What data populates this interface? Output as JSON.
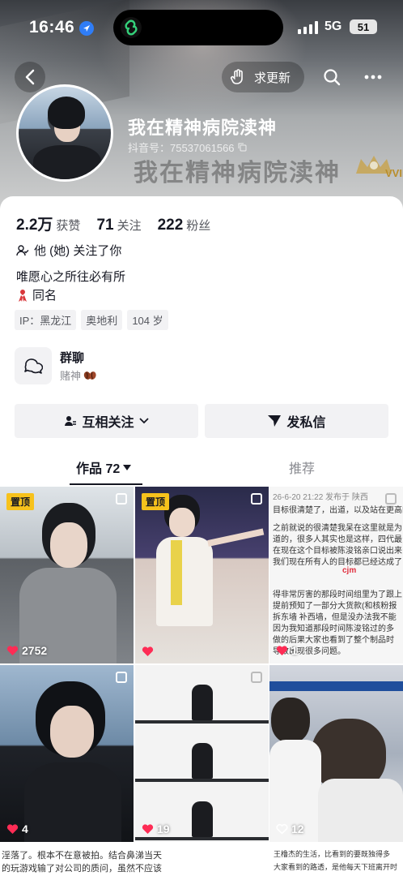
{
  "status_bar": {
    "time": "16:46",
    "network": "5G",
    "battery": "51"
  },
  "header": {
    "update_label": "求更新",
    "nickname": "我在精神病院渎神",
    "douyin_id": "抖音号：75537061566",
    "ghost_name": "我在精神病院渎神",
    "vip_label": "VVIP"
  },
  "stats": [
    {
      "value": "2.2万",
      "label": "获赞"
    },
    {
      "value": "71",
      "label": "关注"
    },
    {
      "value": "222",
      "label": "粉丝"
    }
  ],
  "profile": {
    "follows_you": "他 (她) 关注了你",
    "bio_line1": "唯愿心之所往必有所",
    "bio_line2": "同名",
    "tags": [
      "IP：黑龙江",
      "奥地利",
      "104 岁"
    ]
  },
  "group_chat": {
    "title": "群聊",
    "subtitle": "赌神"
  },
  "actions": {
    "follow_label": "互相关注",
    "message_label": "发私信"
  },
  "tabs": {
    "works_label": "作品 72",
    "recommend_label": "推荐"
  },
  "grid": {
    "pinned_label": "置顶",
    "items": [
      {
        "likes": "2752"
      },
      {
        "likes": ""
      },
      {
        "likes": "1"
      },
      {
        "likes": "4"
      },
      {
        "likes": "19"
      },
      {
        "likes": "12"
      }
    ],
    "doc_date": "26-6-20 21:22  发布于 陕西",
    "doc_lines": [
      "目标很清楚了，出道，以及站在更高的",
      "之前就说的很清楚我呆在这里就是为",
      "道的，很多人其实也是这样，四代最",
      "在现在这个目标被陈浚铭亲口说出来",
      "我们现在所有人的目标都已经达成了",
      "得非常厉害的那段时间组里为了跟上",
      "提前预知了一部分大货款(和核粉报",
      "拆东墙 补西墙，但是没办法我不能",
      "因为我知道那段时间陈浚铭过的多",
      "做的后果大家也看到了整个制品时",
      "导致出现很多问题。"
    ],
    "doc_mark": "cjm",
    "bottom_texts": [
      "淫落了。根本不在意被拍。结合鼻涕当天",
      "的玩游戏输了对公司的质问，虽然不应该",
      "王橹杰的生活，比看到的要既独得多",
      "大家看到的路透，是他每天下班离开时"
    ]
  }
}
